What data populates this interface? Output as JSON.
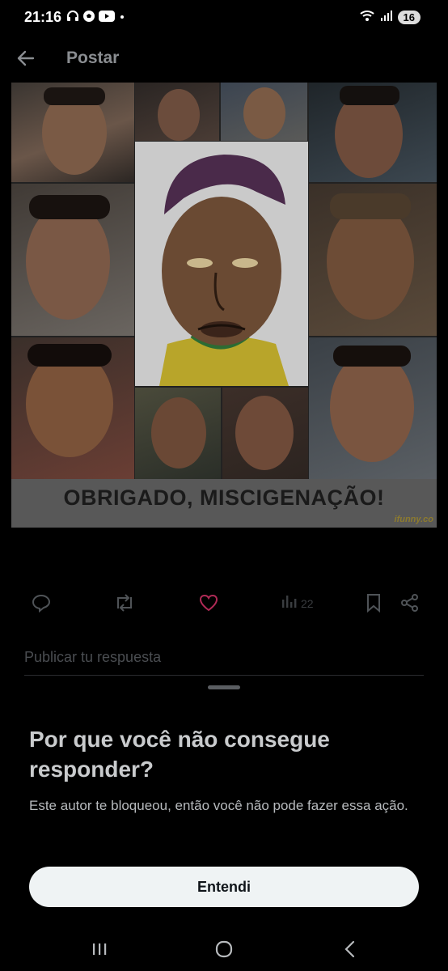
{
  "status_bar": {
    "time": "21:16",
    "left_icons": [
      "headphones-icon",
      "soccer-ball-icon",
      "youtube-icon",
      "dot-icon"
    ],
    "right_icons": [
      "wifi-icon",
      "signal-icon"
    ],
    "battery": "16"
  },
  "header": {
    "title": "Postar",
    "back_icon": "arrow-left-icon"
  },
  "post": {
    "meme_caption": "OBRIGADO, MISCIGENAÇÃO!",
    "watermark": "ifunny.co"
  },
  "actions": {
    "reply_icon": "reply-icon",
    "repost_icon": "repost-icon",
    "like_icon": "heart-icon",
    "views_icon": "views-icon",
    "views_count": "22",
    "bookmark_icon": "bookmark-icon",
    "share_icon": "share-icon",
    "like_color": "#b02a56"
  },
  "reply_field": {
    "placeholder": "Publicar tu respuesta"
  },
  "sheet": {
    "title": "Por que você não consegue responder?",
    "body": "Este autor te bloqueou, então você não pode fazer essa ação.",
    "button_label": "Entendi"
  },
  "nav": {
    "recents_icon": "recents-icon",
    "home_icon": "home-icon",
    "back_icon": "nav-back-icon"
  }
}
